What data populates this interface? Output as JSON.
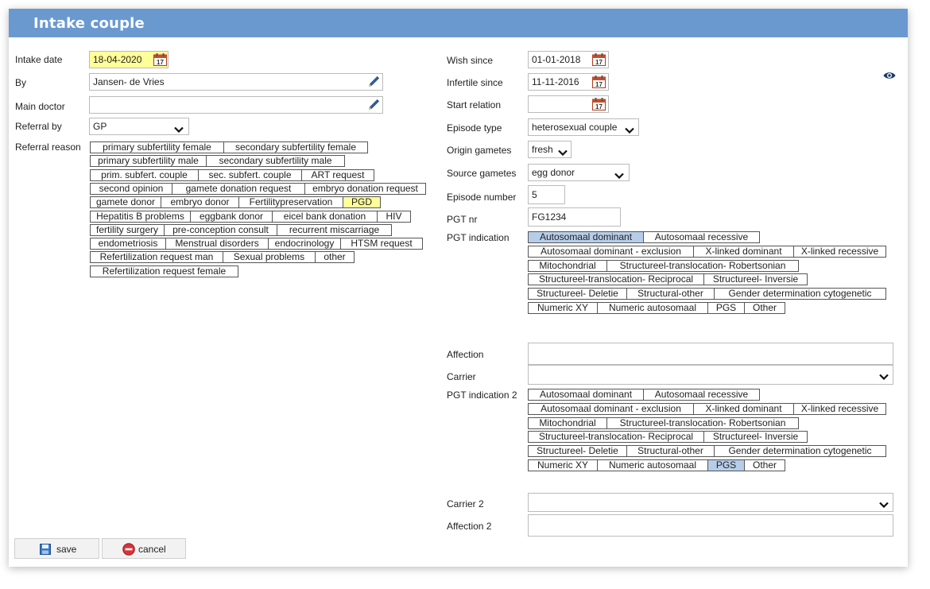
{
  "window": {
    "title": "Intake couple"
  },
  "left": {
    "intake_date": {
      "label": "Intake date",
      "value": "18-04-2020"
    },
    "by": {
      "label": "By",
      "value": "Jansen- de Vries"
    },
    "main_doctor": {
      "label": "Main doctor",
      "value": ""
    },
    "referral_by": {
      "label": "Referral by",
      "value": "GP"
    },
    "referral_reason": {
      "label": "Referral reason",
      "tags": [
        {
          "label": "primary subfertility female",
          "selected": false
        },
        {
          "label": "secondary subfertility female",
          "selected": false
        },
        {
          "label": "primary subfertility male",
          "selected": false
        },
        {
          "label": "secondary subfertility male",
          "selected": false
        },
        {
          "label": "prim. subfert. couple",
          "selected": false
        },
        {
          "label": "sec. subfert. couple",
          "selected": false
        },
        {
          "label": "ART request",
          "selected": false
        },
        {
          "label": "second opinion",
          "selected": false
        },
        {
          "label": "gamete donation request",
          "selected": false
        },
        {
          "label": "embryo donation request",
          "selected": false
        },
        {
          "label": "gamete donor",
          "selected": false
        },
        {
          "label": "embryo donor",
          "selected": false
        },
        {
          "label": "Fertilitypreservation",
          "selected": false
        },
        {
          "label": "PGD",
          "selected": true
        },
        {
          "label": "Hepatitis B problems",
          "selected": false
        },
        {
          "label": "eggbank donor",
          "selected": false
        },
        {
          "label": "eicel bank donation",
          "selected": false
        },
        {
          "label": "HIV",
          "selected": false
        },
        {
          "label": "fertility surgery",
          "selected": false
        },
        {
          "label": "pre-conception consult",
          "selected": false
        },
        {
          "label": "recurrent miscarriage",
          "selected": false
        },
        {
          "label": "endometriosis",
          "selected": false
        },
        {
          "label": "Menstrual disorders",
          "selected": false
        },
        {
          "label": "endocrinology",
          "selected": false
        },
        {
          "label": "HTSM request",
          "selected": false
        },
        {
          "label": "Refertilization request man",
          "selected": false
        },
        {
          "label": "Sexual problems",
          "selected": false
        },
        {
          "label": "other",
          "selected": false
        },
        {
          "label": "Refertilization request female",
          "selected": false
        }
      ]
    }
  },
  "right": {
    "wish_since": {
      "label": "Wish since",
      "value": "01-01-2018"
    },
    "infertile_since": {
      "label": "Infertile since",
      "value": "11-11-2016"
    },
    "start_relation": {
      "label": "Start relation",
      "value": ""
    },
    "episode_type": {
      "label": "Episode type",
      "value": "heterosexual couple"
    },
    "origin_gametes": {
      "label": "Origin gametes",
      "value": "fresh"
    },
    "source_gametes": {
      "label": "Source gametes",
      "value": "egg donor"
    },
    "episode_number": {
      "label": "Episode number",
      "value": "5"
    },
    "pgt_nr": {
      "label": "PGT nr",
      "value": "FG1234"
    },
    "pgt_indication": {
      "label": "PGT indication",
      "tags": [
        {
          "label": "Autosomaal dominant",
          "selected": true
        },
        {
          "label": "Autosomaal recessive",
          "selected": false
        },
        {
          "label": "Autosomaal dominant - exclusion",
          "selected": false
        },
        {
          "label": "X-linked dominant",
          "selected": false
        },
        {
          "label": "X-linked recessive",
          "selected": false
        },
        {
          "label": "Mitochondrial",
          "selected": false
        },
        {
          "label": "Structureel-translocation- Robertsonian",
          "selected": false
        },
        {
          "label": "Structureel-translocation- Reciprocal",
          "selected": false
        },
        {
          "label": "Structureel- Inversie",
          "selected": false
        },
        {
          "label": "Structureel- Deletie",
          "selected": false
        },
        {
          "label": "Structural-other",
          "selected": false
        },
        {
          "label": "Gender determination cytogenetic",
          "selected": false
        },
        {
          "label": "Numeric XY",
          "selected": false
        },
        {
          "label": "Numeric autosomaal",
          "selected": false
        },
        {
          "label": "PGS",
          "selected": false
        },
        {
          "label": "Other",
          "selected": false
        }
      ]
    },
    "affection": {
      "label": "Affection",
      "value": ""
    },
    "carrier": {
      "label": "Carrier",
      "value": ""
    },
    "pgt_indication_2": {
      "label": "PGT indication 2",
      "tags": [
        {
          "label": "Autosomaal dominant",
          "selected": false
        },
        {
          "label": "Autosomaal recessive",
          "selected": false
        },
        {
          "label": "Autosomaal dominant - exclusion",
          "selected": false
        },
        {
          "label": "X-linked dominant",
          "selected": false
        },
        {
          "label": "X-linked recessive",
          "selected": false
        },
        {
          "label": "Mitochondrial",
          "selected": false
        },
        {
          "label": "Structureel-translocation- Robertsonian",
          "selected": false
        },
        {
          "label": "Structureel-translocation- Reciprocal",
          "selected": false
        },
        {
          "label": "Structureel- Inversie",
          "selected": false
        },
        {
          "label": "Structureel- Deletie",
          "selected": false
        },
        {
          "label": "Structural-other",
          "selected": false
        },
        {
          "label": "Gender determination cytogenetic",
          "selected": false
        },
        {
          "label": "Numeric XY",
          "selected": false
        },
        {
          "label": "Numeric autosomaal",
          "selected": false
        },
        {
          "label": "PGS",
          "selected": true
        },
        {
          "label": "Other",
          "selected": false
        }
      ]
    },
    "carrier_2": {
      "label": "Carrier 2",
      "value": ""
    },
    "affection_2": {
      "label": "Affection 2",
      "value": ""
    }
  },
  "footer": {
    "save_label": "save",
    "cancel_label": "cancel"
  },
  "icons": {
    "calendar": "calendar-icon",
    "pencil": "pencil-icon",
    "chevron": "chevron-down-icon",
    "eye": "eye-icon",
    "save": "save-icon",
    "cancel": "cancel-icon"
  },
  "colors": {
    "title_bar": "#6a99d0",
    "yellow_highlight": "#ffff99",
    "blue_selected": "#b6cde9"
  }
}
